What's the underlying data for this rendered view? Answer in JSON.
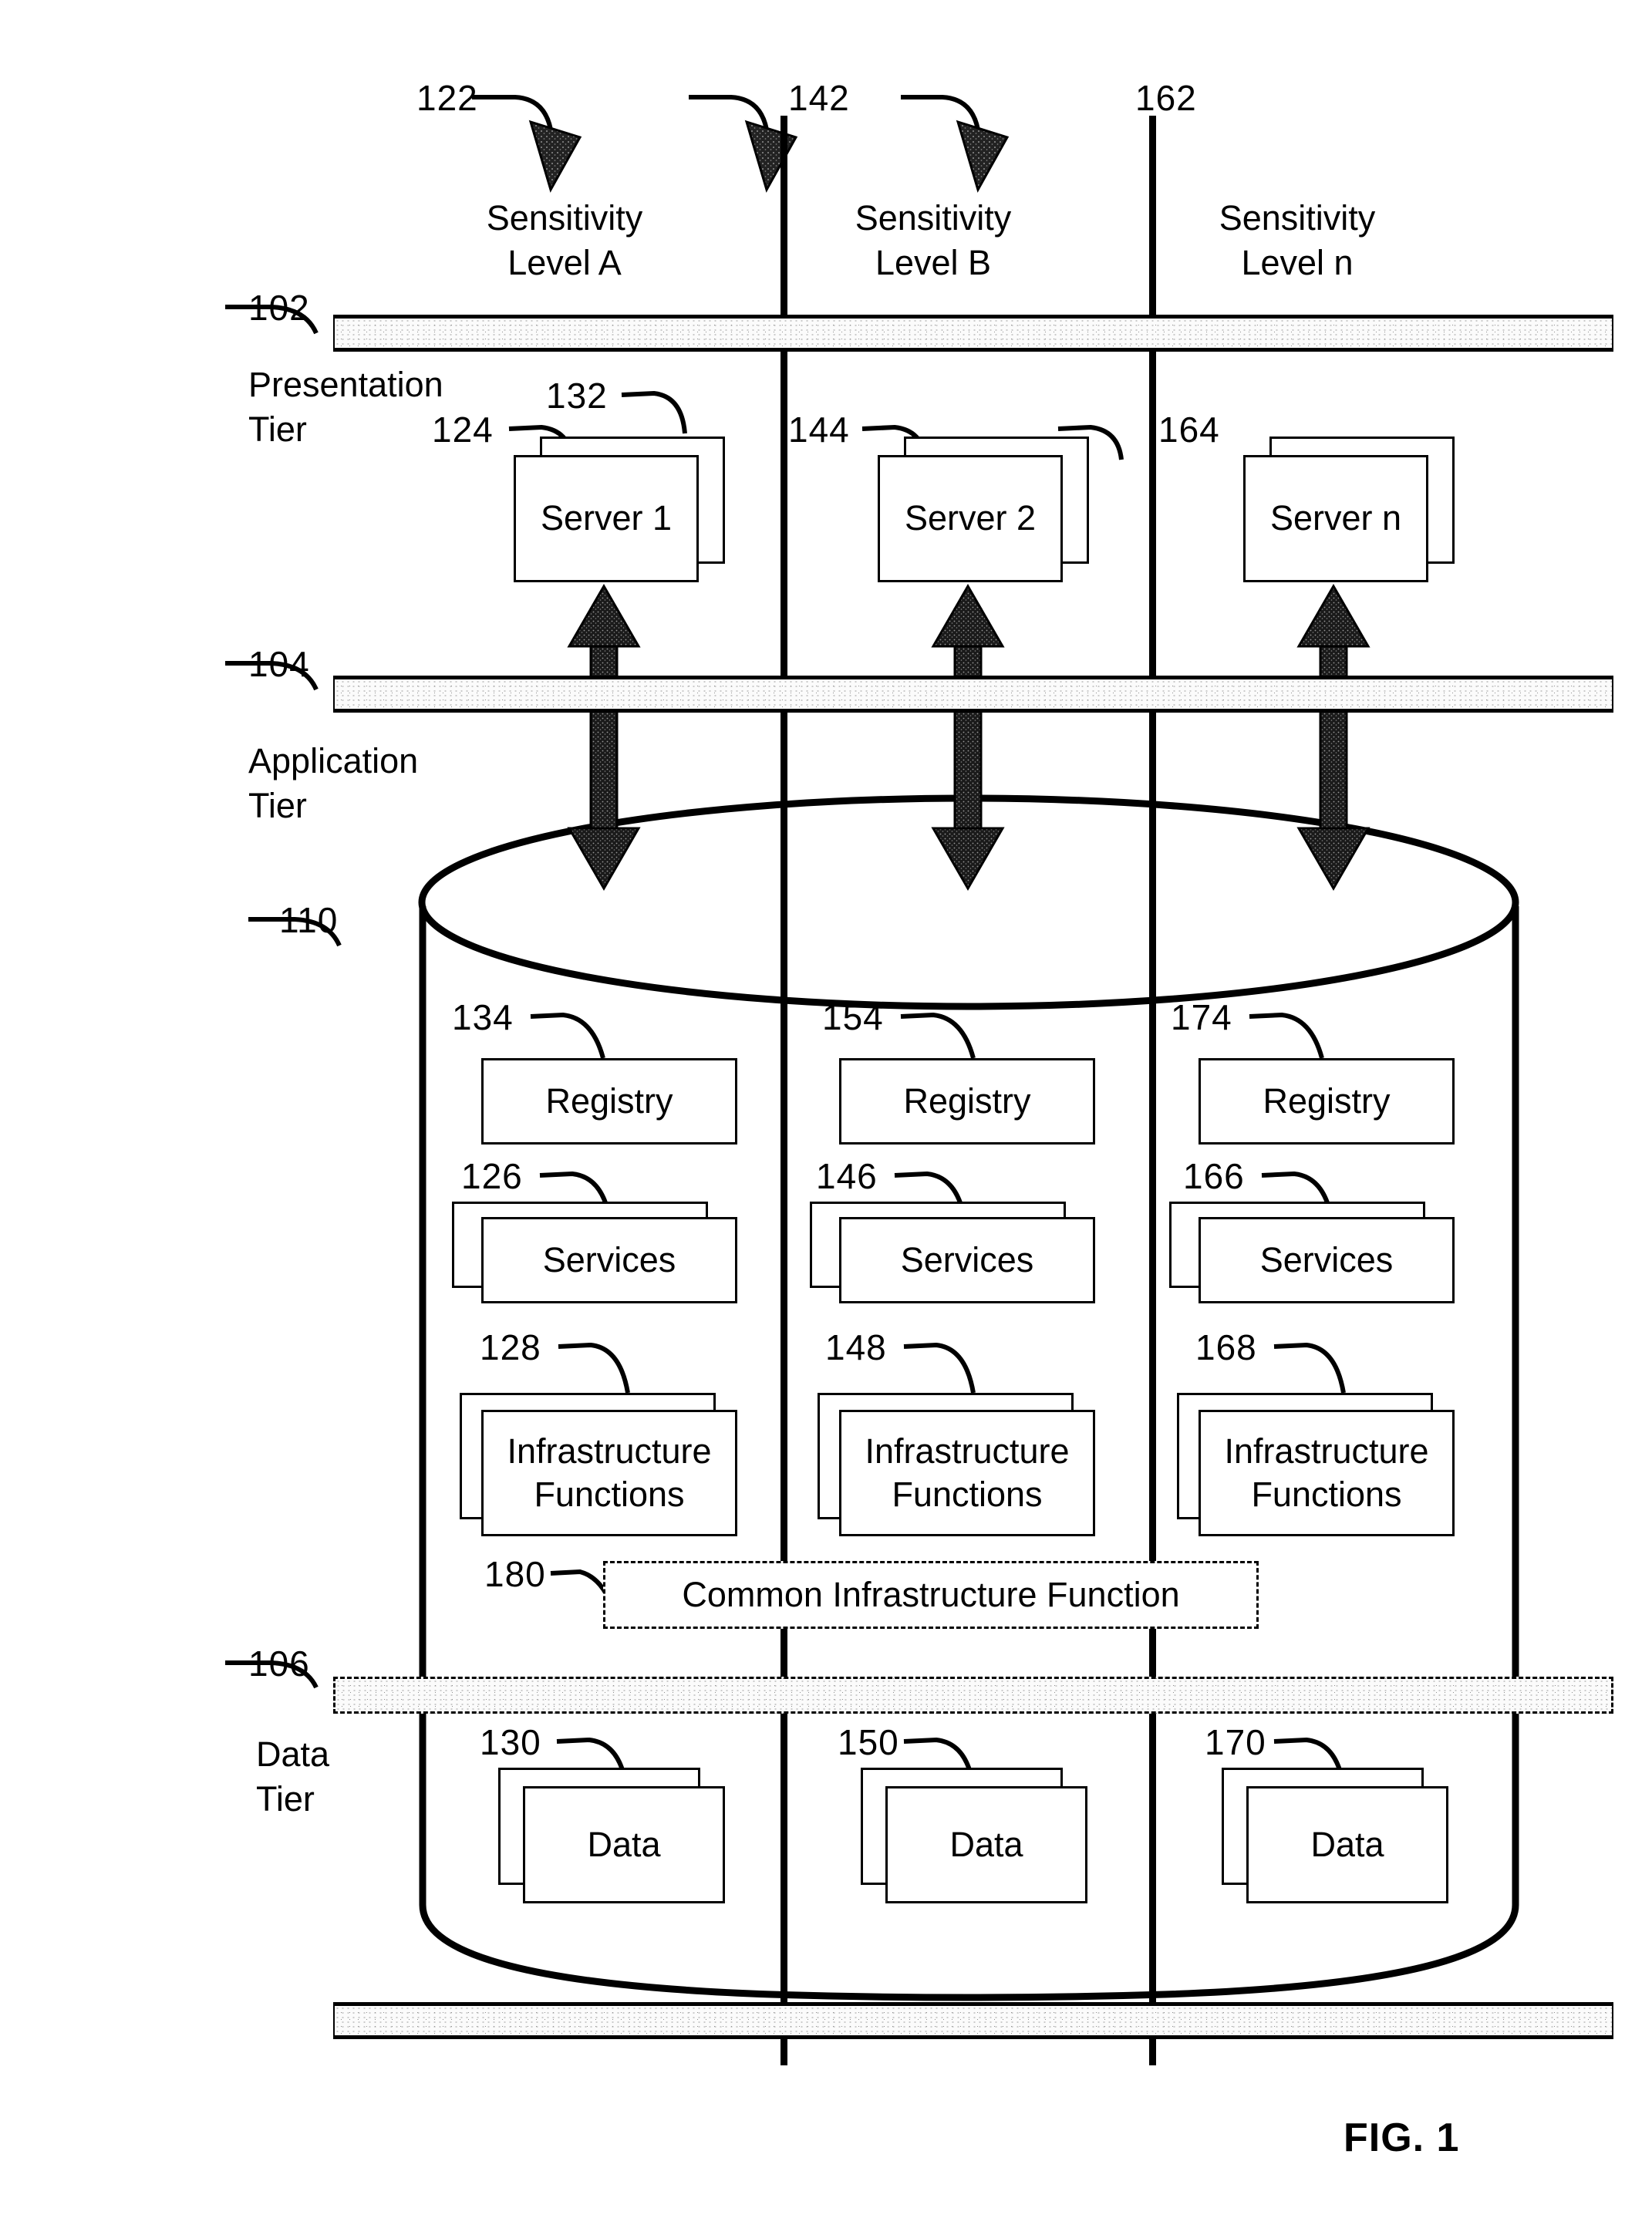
{
  "figure": {
    "label": "FIG. 1"
  },
  "columns": [
    {
      "ref": "122",
      "title_line1": "Sensitivity",
      "title_line2": "Level A"
    },
    {
      "ref": "142",
      "title_line1": "Sensitivity",
      "title_line2": "Level B"
    },
    {
      "ref": "162",
      "title_line1": "Sensitivity",
      "title_line2": "Level n"
    }
  ],
  "tiers": [
    {
      "ref": "102",
      "name_line1": "Presentation",
      "name_line2": "Tier"
    },
    {
      "ref": "104",
      "name_line1": "Application",
      "name_line2": "Tier"
    },
    {
      "ref": "106",
      "name_line1": "Data",
      "name_line2": "Tier"
    }
  ],
  "cylinder": {
    "ref": "110"
  },
  "servers": [
    {
      "ref_back": "132",
      "ref_front": "124",
      "label": "Server 1"
    },
    {
      "ref_front": "144",
      "label": "Server 2"
    },
    {
      "ref_front": "164",
      "label": "Server n"
    }
  ],
  "registries": [
    {
      "ref": "134",
      "label": "Registry"
    },
    {
      "ref": "154",
      "label": "Registry"
    },
    {
      "ref": "174",
      "label": "Registry"
    }
  ],
  "services": [
    {
      "ref": "126",
      "label": "Services"
    },
    {
      "ref": "146",
      "label": "Services"
    },
    {
      "ref": "166",
      "label": "Services"
    }
  ],
  "infrastructure": [
    {
      "ref": "128",
      "label_line1": "Infrastructure",
      "label_line2": "Functions"
    },
    {
      "ref": "148",
      "label_line1": "Infrastructure",
      "label_line2": "Functions"
    },
    {
      "ref": "168",
      "label_line1": "Infrastructure",
      "label_line2": "Functions"
    }
  ],
  "common": {
    "ref": "180",
    "label": "Common Infrastructure Function"
  },
  "data_stores": [
    {
      "ref": "130",
      "label": "Data"
    },
    {
      "ref": "150",
      "label": "Data"
    },
    {
      "ref": "170",
      "label": "Data"
    }
  ],
  "colors": {
    "line": "#000000",
    "bar_fill": "#ededed",
    "background": "#ffffff"
  }
}
